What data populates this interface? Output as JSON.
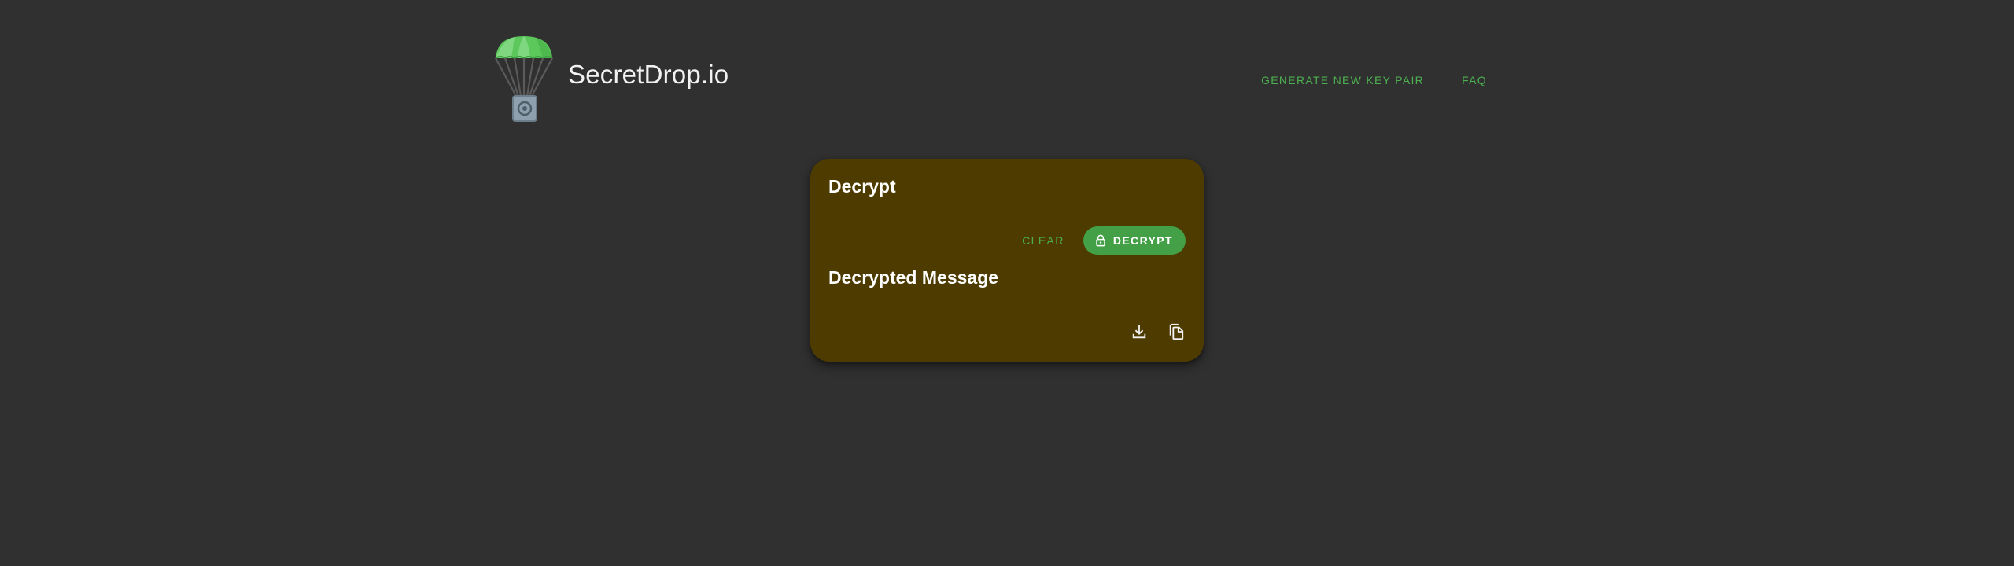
{
  "brand": {
    "name": "SecretDrop.io",
    "logo_icon": "parachute-lockbox-icon"
  },
  "nav": {
    "generate_key_pair": "GENERATE NEW KEY PAIR",
    "faq": "FAQ"
  },
  "card": {
    "title": "Decrypt",
    "clear_label": "CLEAR",
    "decrypt_label": "DECRYPT",
    "decrypt_icon": "lock-icon",
    "decrypted_title": "Decrypted Message",
    "download_icon": "download-icon",
    "copy_icon": "copy-icon"
  },
  "colors": {
    "background": "#303030",
    "accent": "#4caf50",
    "primary_button": "#43a047",
    "card": "#4e3b00"
  }
}
